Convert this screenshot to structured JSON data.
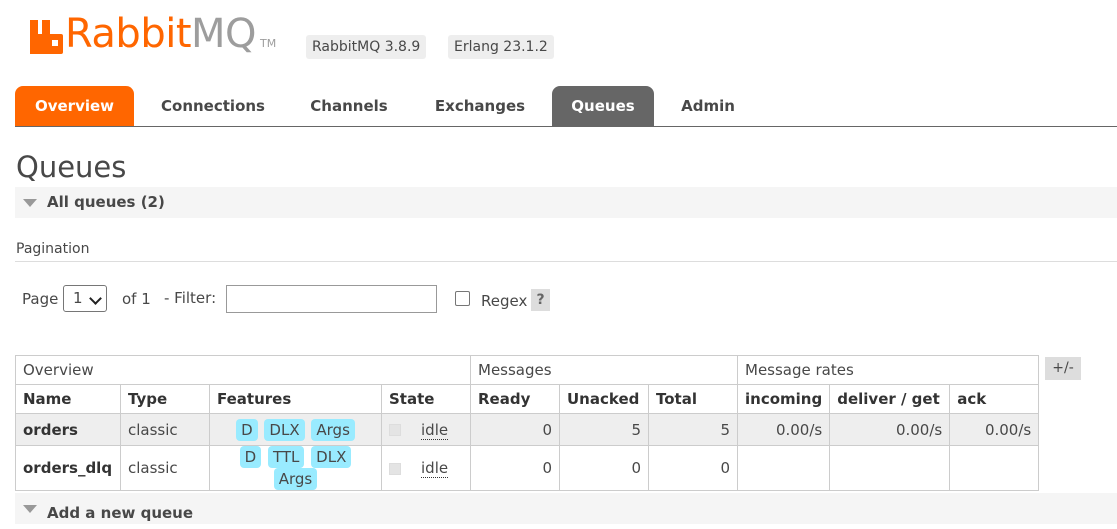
{
  "header": {
    "logo_primary": "Rabbit",
    "logo_secondary": "MQ",
    "logo_tm": "TM",
    "version_badge": "RabbitMQ 3.8.9",
    "erlang_badge": "Erlang 23.1.2"
  },
  "tabs": [
    {
      "label": "Overview"
    },
    {
      "label": "Connections"
    },
    {
      "label": "Channels"
    },
    {
      "label": "Exchanges"
    },
    {
      "label": "Queues"
    },
    {
      "label": "Admin"
    }
  ],
  "page_title": "Queues",
  "all_queues_label": "All queues (2)",
  "pagination": {
    "heading": "Pagination",
    "page_label": "Page",
    "page_value": "1",
    "of_label": "of 1",
    "filter_label": "- Filter:",
    "filter_value": "",
    "regex_label": "Regex",
    "help_label": "?"
  },
  "table": {
    "groups": [
      "Overview",
      "Messages",
      "Message rates"
    ],
    "toggle_label": "+/-",
    "columns": [
      "Name",
      "Type",
      "Features",
      "State",
      "Ready",
      "Unacked",
      "Total",
      "incoming",
      "deliver / get",
      "ack"
    ],
    "rows": [
      {
        "name": "orders",
        "type": "classic",
        "features": [
          "D",
          "DLX",
          "Args"
        ],
        "state": "idle",
        "ready": "0",
        "unacked": "5",
        "total": "5",
        "incoming": "0.00/s",
        "deliver_get": "0.00/s",
        "ack": "0.00/s"
      },
      {
        "name": "orders_dlq",
        "type": "classic",
        "features": [
          "D",
          "TTL",
          "DLX",
          "Args"
        ],
        "state": "idle",
        "ready": "0",
        "unacked": "0",
        "total": "0",
        "incoming": "",
        "deliver_get": "",
        "ack": ""
      }
    ]
  },
  "add_queue_label": "Add a new queue"
}
